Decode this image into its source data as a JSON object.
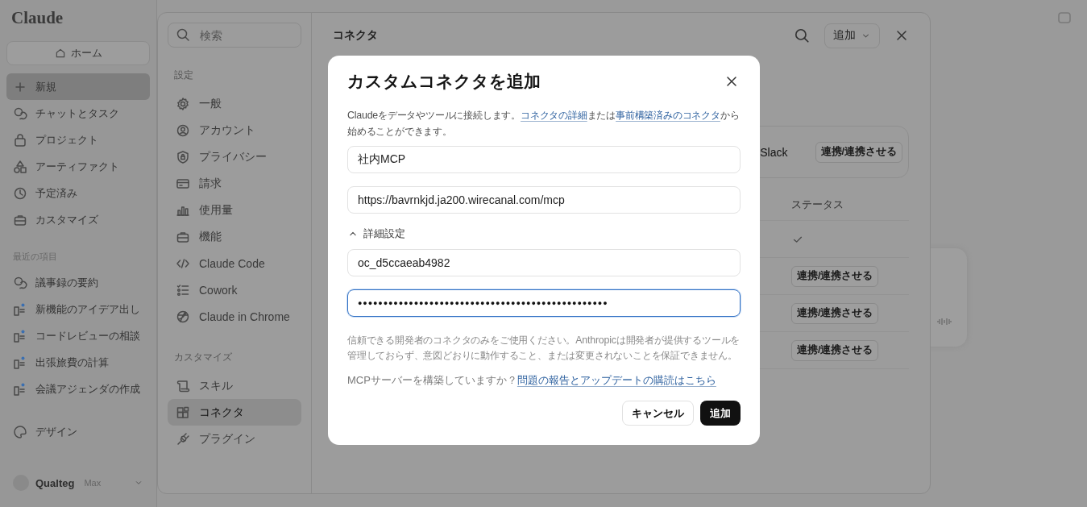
{
  "app_sidebar": {
    "logo": "Claude",
    "home_button": "ホーム",
    "nav": [
      {
        "label": "新規",
        "selected": true
      },
      {
        "label": "チャットとタスク",
        "selected": false
      },
      {
        "label": "プロジェクト",
        "selected": false
      },
      {
        "label": "アーティファクト",
        "selected": false
      },
      {
        "label": "予定済み",
        "selected": false
      },
      {
        "label": "カスタマイズ",
        "selected": false
      }
    ],
    "recents_heading": "最近の項目",
    "recents": [
      {
        "label": "議事録の要約",
        "kind": "chat"
      },
      {
        "label": "新機能のアイデア出し",
        "kind": "task"
      },
      {
        "label": "コードレビューの相談",
        "kind": "task"
      },
      {
        "label": "出張旅費の計算",
        "kind": "task"
      },
      {
        "label": "会議アジェンダの作成",
        "kind": "task"
      }
    ],
    "design": "デザイン",
    "account": {
      "name": "Qualteg",
      "plan": "Max"
    }
  },
  "settings": {
    "search_placeholder": "検索",
    "sections": [
      {
        "heading": "設定",
        "items": [
          {
            "label": "一般",
            "selected": false
          },
          {
            "label": "アカウント",
            "selected": false
          },
          {
            "label": "プライバシー",
            "selected": false
          },
          {
            "label": "請求",
            "selected": false
          },
          {
            "label": "使用量",
            "selected": false
          },
          {
            "label": "機能",
            "selected": false
          },
          {
            "label": "Claude Code",
            "selected": false
          },
          {
            "label": "Cowork",
            "selected": false
          },
          {
            "label": "Claude in Chrome",
            "selected": false
          }
        ]
      },
      {
        "heading": "カスタマイズ",
        "items": [
          {
            "label": "スキル",
            "selected": false
          },
          {
            "label": "コネクタ",
            "selected": true
          },
          {
            "label": "プラグイン",
            "selected": false
          }
        ]
      }
    ],
    "page_title": "コネクタ",
    "add_button": "追加",
    "featured": {
      "name": "Slack",
      "button": "連携/連携させる"
    },
    "status_heading": "ステータス",
    "rows": [
      {
        "kind": "check"
      },
      {
        "kind": "button",
        "label": "連携/連携させる"
      },
      {
        "kind": "button",
        "label": "連携/連携させる"
      },
      {
        "kind": "button",
        "label": "連携/連携させる"
      }
    ]
  },
  "modal": {
    "title": "カスタムコネクタを追加",
    "description": [
      {
        "text": "Claudeをデータやツールに接続します。",
        "kind": "text"
      },
      {
        "text": "コネクタの詳細",
        "kind": "link"
      },
      {
        "text": "または",
        "kind": "text"
      },
      {
        "text": "事前構築済みのコネクタ",
        "kind": "link"
      },
      {
        "text": "から始めることができます。",
        "kind": "text"
      }
    ],
    "fields": [
      {
        "value": "社内MCP",
        "focused": false
      },
      {
        "value": "https://bavrnkjd.ja200.wirecanal.com/mcp",
        "focused": false
      }
    ],
    "advanced": {
      "label": "詳細設定",
      "expanded": true
    },
    "advanced_fields": [
      {
        "value": "oc_d5ccaeab4982",
        "focused": false,
        "kind": "text"
      },
      {
        "value": "●●●●●●●●●●●●●●●●●●●●●●●●●●●●●●●●●●●●●●●●●●●●●●●●●",
        "focused": true,
        "kind": "password"
      }
    ],
    "warning": "信頼できる開発者のコネクタのみをご使用ください。Anthropicは開発者が提供するツールを管理しておらず、意図どおりに動作すること、または変更されないことを保証できません。",
    "builder_question": "MCPサーバーを構築していますか？",
    "builder_link": "問題の報告とアップデートの購読はこちら",
    "cancel": "キャンセル",
    "submit": "追加"
  }
}
